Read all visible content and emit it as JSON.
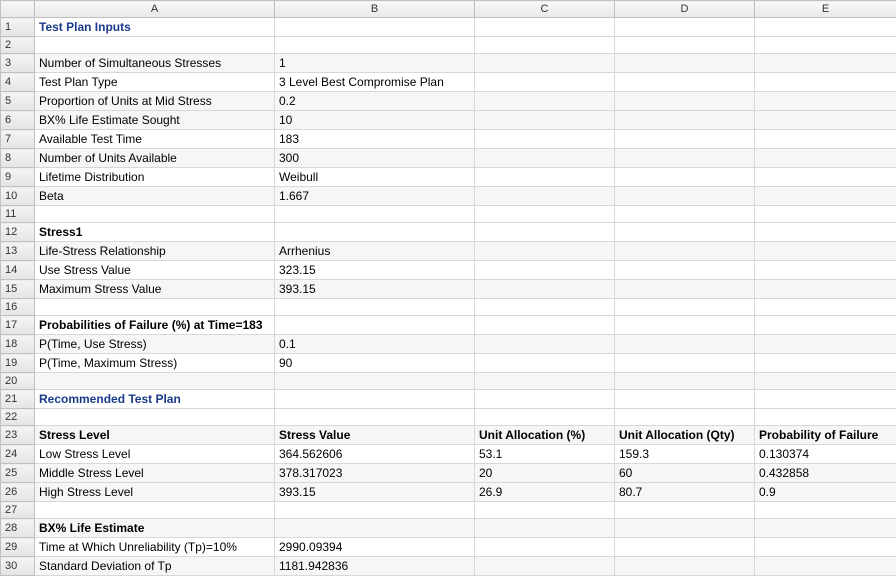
{
  "columns": [
    "A",
    "B",
    "C",
    "D",
    "E"
  ],
  "rows": [
    {
      "n": 1,
      "alt": false,
      "cells": [
        "Test Plan Inputs",
        "",
        "",
        "",
        ""
      ],
      "classA": "title"
    },
    {
      "n": 2,
      "alt": false,
      "cells": [
        "",
        "",
        "",
        "",
        ""
      ]
    },
    {
      "n": 3,
      "alt": true,
      "cells": [
        "Number of Simultaneous Stresses",
        "1",
        "",
        "",
        ""
      ]
    },
    {
      "n": 4,
      "alt": false,
      "cells": [
        "Test Plan Type",
        "3 Level Best Compromise Plan",
        "",
        "",
        ""
      ]
    },
    {
      "n": 5,
      "alt": true,
      "cells": [
        "Proportion of Units at Mid Stress",
        "0.2",
        "",
        "",
        ""
      ]
    },
    {
      "n": 6,
      "alt": true,
      "cells": [
        "BX% Life Estimate Sought",
        "10",
        "",
        "",
        ""
      ]
    },
    {
      "n": 7,
      "alt": false,
      "cells": [
        "Available Test Time",
        "183",
        "",
        "",
        ""
      ]
    },
    {
      "n": 8,
      "alt": true,
      "cells": [
        "Number of Units Available",
        "300",
        "",
        "",
        ""
      ]
    },
    {
      "n": 9,
      "alt": false,
      "cells": [
        "Lifetime Distribution",
        "Weibull",
        "",
        "",
        ""
      ]
    },
    {
      "n": 10,
      "alt": true,
      "cells": [
        "Beta",
        "1.667",
        "",
        "",
        ""
      ]
    },
    {
      "n": 11,
      "alt": false,
      "cells": [
        "",
        "",
        "",
        "",
        ""
      ]
    },
    {
      "n": 12,
      "alt": false,
      "cells": [
        "Stress1",
        "",
        "",
        "",
        ""
      ],
      "classA": "boldblack"
    },
    {
      "n": 13,
      "alt": true,
      "cells": [
        "Life-Stress Relationship",
        "Arrhenius",
        "",
        "",
        ""
      ]
    },
    {
      "n": 14,
      "alt": false,
      "cells": [
        "Use Stress Value",
        "323.15",
        "",
        "",
        ""
      ]
    },
    {
      "n": 15,
      "alt": true,
      "cells": [
        "Maximum Stress Value",
        "393.15",
        "",
        "",
        ""
      ]
    },
    {
      "n": 16,
      "alt": false,
      "cells": [
        "",
        "",
        "",
        "",
        ""
      ]
    },
    {
      "n": 17,
      "alt": false,
      "cells": [
        "Probabilities of Failure (%) at Time=183",
        "",
        "",
        "",
        ""
      ],
      "classA": "boldblack"
    },
    {
      "n": 18,
      "alt": true,
      "cells": [
        "P(Time, Use Stress)",
        "0.1",
        "",
        "",
        ""
      ]
    },
    {
      "n": 19,
      "alt": false,
      "cells": [
        "P(Time, Maximum Stress)",
        "90",
        "",
        "",
        ""
      ]
    },
    {
      "n": 20,
      "alt": true,
      "cells": [
        "",
        "",
        "",
        "",
        ""
      ]
    },
    {
      "n": 21,
      "alt": false,
      "cells": [
        "Recommended Test Plan",
        "",
        "",
        "",
        ""
      ],
      "classA": "title"
    },
    {
      "n": 22,
      "alt": false,
      "cells": [
        "",
        "",
        "",
        "",
        ""
      ]
    },
    {
      "n": 23,
      "alt": true,
      "cells": [
        "Stress Level",
        "Stress Value",
        "Unit Allocation (%)",
        "Unit Allocation (Qty)",
        "Probability of Failure"
      ],
      "classRow": "boldblack"
    },
    {
      "n": 24,
      "alt": false,
      "cells": [
        "Low Stress Level",
        "364.562606",
        "53.1",
        "159.3",
        "0.130374"
      ]
    },
    {
      "n": 25,
      "alt": true,
      "cells": [
        "Middle Stress Level",
        "378.317023",
        "20",
        "60",
        "0.432858"
      ]
    },
    {
      "n": 26,
      "alt": true,
      "cells": [
        "High Stress Level",
        "393.15",
        "26.9",
        "80.7",
        "0.9"
      ]
    },
    {
      "n": 27,
      "alt": false,
      "cells": [
        "",
        "",
        "",
        "",
        ""
      ]
    },
    {
      "n": 28,
      "alt": true,
      "cells": [
        "BX% Life Estimate",
        "",
        "",
        "",
        ""
      ],
      "classA": "boldblack"
    },
    {
      "n": 29,
      "alt": false,
      "cells": [
        "Time at Which Unreliability (Tp)=10%",
        "2990.09394",
        "",
        "",
        ""
      ]
    },
    {
      "n": 30,
      "alt": true,
      "cells": [
        "Standard Deviation of Tp",
        "1181.942836",
        "",
        "",
        ""
      ]
    }
  ],
  "chart_data": {
    "type": "table",
    "title": "Test Plan Inputs / Recommended Test Plan",
    "inputs": {
      "Number of Simultaneous Stresses": 1,
      "Test Plan Type": "3 Level Best Compromise Plan",
      "Proportion of Units at Mid Stress": 0.2,
      "BX% Life Estimate Sought": 10,
      "Available Test Time": 183,
      "Number of Units Available": 300,
      "Lifetime Distribution": "Weibull",
      "Beta": 1.667
    },
    "stress1": {
      "Life-Stress Relationship": "Arrhenius",
      "Use Stress Value": 323.15,
      "Maximum Stress Value": 393.15
    },
    "prob_failure_at_time": {
      "time": 183,
      "P(Time, Use Stress)": 0.1,
      "P(Time, Maximum Stress)": 90
    },
    "recommended_plan": {
      "columns": [
        "Stress Level",
        "Stress Value",
        "Unit Allocation (%)",
        "Unit Allocation (Qty)",
        "Probability of Failure"
      ],
      "rows": [
        [
          "Low Stress Level",
          364.562606,
          53.1,
          159.3,
          0.130374
        ],
        [
          "Middle Stress Level",
          378.317023,
          20,
          60,
          0.432858
        ],
        [
          "High Stress Level",
          393.15,
          26.9,
          80.7,
          0.9
        ]
      ]
    },
    "bx_life_estimate": {
      "Time at Which Unreliability (Tp)=10%": 2990.09394,
      "Standard Deviation of Tp": 1181.942836
    }
  }
}
